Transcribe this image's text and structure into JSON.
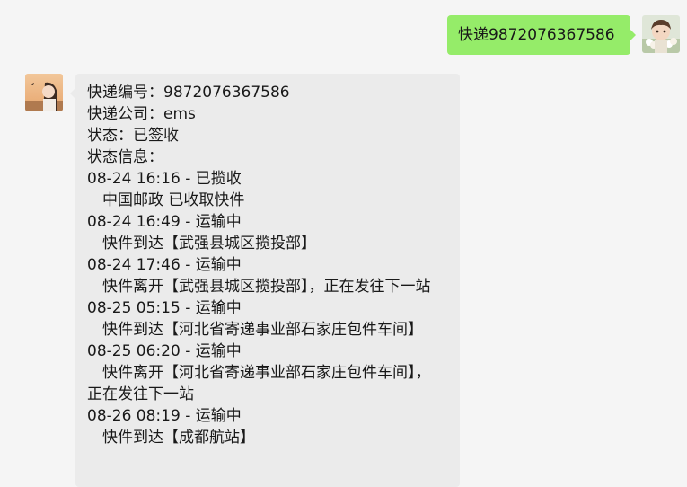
{
  "conversation": {
    "outgoing": {
      "text": "快递9872076367586"
    },
    "incoming": {
      "tracking_number_line": "快递编号：9872076367586",
      "courier_line": "快递公司：ems",
      "status_line": "状态：已签收",
      "info_heading": "状态信息：",
      "events": [
        {
          "header": "08-24 16:16 - 已揽收",
          "detail": "　中国邮政 已收取快件"
        },
        {
          "header": "08-24 16:49 - 运输中",
          "detail": "　快件到达【武强县城区揽投部】"
        },
        {
          "header": "08-24 17:46 - 运输中",
          "detail": "　快件离开【武强县城区揽投部】，正在发往下一站"
        },
        {
          "header": "08-25 05:15 - 运输中",
          "detail": "　快件到达【河北省寄递事业部石家庄包件车间】"
        },
        {
          "header": "08-25 06:20 - 运输中",
          "detail": "　快件离开【河北省寄递事业部石家庄包件车间】，正在发往下一站"
        },
        {
          "header": "08-26 08:19 - 运输中",
          "detail": "　快件到达【成都航站】"
        }
      ]
    }
  },
  "colors": {
    "background": "#f5f5f5",
    "outgoing_bubble": "#95ec69",
    "incoming_bubble": "#ebebeb",
    "text": "#191919"
  }
}
